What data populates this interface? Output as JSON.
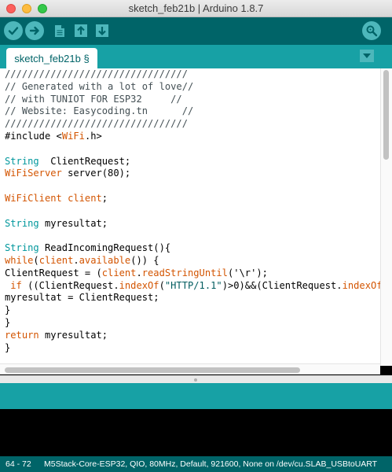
{
  "window": {
    "title": "sketch_feb21b | Arduino 1.8.7"
  },
  "toolbar": {
    "buttons": [
      {
        "name": "verify",
        "icon": "checkmark-icon"
      },
      {
        "name": "upload",
        "icon": "arrow-right-icon"
      },
      {
        "name": "new",
        "icon": "document-icon"
      },
      {
        "name": "open",
        "icon": "arrow-up-icon"
      },
      {
        "name": "save",
        "icon": "arrow-down-icon"
      },
      {
        "name": "serial-monitor",
        "icon": "magnifier-icon"
      }
    ]
  },
  "tabs": [
    {
      "label": "sketch_feb21b §",
      "active": true
    }
  ],
  "editor": {
    "lines": [
      [
        {
          "t": "////////////////////////////////",
          "c": "comment"
        }
      ],
      [
        {
          "t": "// Generated with a lot of love//",
          "c": "comment"
        }
      ],
      [
        {
          "t": "// with TUNIOT FOR ESP32     //",
          "c": "comment"
        }
      ],
      [
        {
          "t": "// Website: Easycoding.tn      //",
          "c": "comment"
        }
      ],
      [
        {
          "t": "////////////////////////////////",
          "c": "comment"
        }
      ],
      [
        {
          "t": "#include <",
          "c": "plain"
        },
        {
          "t": "WiFi",
          "c": "func"
        },
        {
          "t": ".h>",
          "c": "plain"
        }
      ],
      [],
      [
        {
          "t": "String",
          "c": "type"
        },
        {
          "t": "  ClientRequest;",
          "c": "plain"
        }
      ],
      [
        {
          "t": "WiFiServer",
          "c": "func"
        },
        {
          "t": " server(80);",
          "c": "plain"
        }
      ],
      [],
      [
        {
          "t": "WiFiClient",
          "c": "func"
        },
        {
          "t": " ",
          "c": "plain"
        },
        {
          "t": "client",
          "c": "func"
        },
        {
          "t": ";",
          "c": "plain"
        }
      ],
      [],
      [
        {
          "t": "String",
          "c": "type"
        },
        {
          "t": " myresultat;",
          "c": "plain"
        }
      ],
      [],
      [
        {
          "t": "String",
          "c": "type"
        },
        {
          "t": " ReadIncomingRequest(){",
          "c": "plain"
        }
      ],
      [
        {
          "t": "while",
          "c": "func"
        },
        {
          "t": "(",
          "c": "plain"
        },
        {
          "t": "client",
          "c": "func"
        },
        {
          "t": ".",
          "c": "plain"
        },
        {
          "t": "available",
          "c": "func"
        },
        {
          "t": "()) {",
          "c": "plain"
        }
      ],
      [
        {
          "t": "ClientRequest = (",
          "c": "plain"
        },
        {
          "t": "client",
          "c": "func"
        },
        {
          "t": ".",
          "c": "plain"
        },
        {
          "t": "readStringUntil",
          "c": "func"
        },
        {
          "t": "('\\r');",
          "c": "plain"
        }
      ],
      [
        {
          "t": " ",
          "c": "plain"
        },
        {
          "t": "if",
          "c": "func"
        },
        {
          "t": " ((ClientRequest.",
          "c": "plain"
        },
        {
          "t": "indexOf",
          "c": "func"
        },
        {
          "t": "(",
          "c": "plain"
        },
        {
          "t": "\"HTTP/1.1\"",
          "c": "string"
        },
        {
          "t": ")>0)&&(ClientRequest.",
          "c": "plain"
        },
        {
          "t": "indexOf",
          "c": "func"
        },
        {
          "t": "(\"/",
          "c": "plain"
        }
      ],
      [
        {
          "t": "myresultat = ClientRequest;",
          "c": "plain"
        }
      ],
      [
        {
          "t": "}",
          "c": "plain"
        }
      ],
      [
        {
          "t": "}",
          "c": "plain"
        }
      ],
      [
        {
          "t": "return",
          "c": "func"
        },
        {
          "t": " myresultat;",
          "c": "plain"
        }
      ],
      [
        {
          "t": "}",
          "c": "plain"
        }
      ]
    ]
  },
  "status_bar": {
    "line_range": "64 - 72",
    "board_info": "M5Stack-Core-ESP32, QIO, 80MHz, Default, 921600, None on /dev/cu.SLAB_USBtoUART"
  },
  "colors": {
    "toolbar_bg": "#006468",
    "tab_bar_bg": "#17a1a5",
    "button_bg": "#4db7bb",
    "keyword_orange": "#d35400",
    "type_teal": "#00979c"
  }
}
